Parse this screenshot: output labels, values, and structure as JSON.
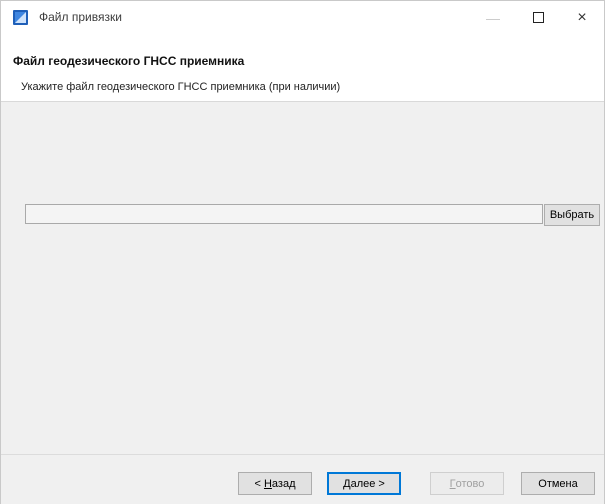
{
  "window": {
    "title": "Файл привязки",
    "controls": {
      "minimize": "—",
      "maximize": "",
      "close": "×"
    }
  },
  "header": {
    "title": "Файл геодезического ГНСС приемника",
    "subtitle": "Укажите файл геодезического ГНСС приемника (при наличии)"
  },
  "content": {
    "file_path_value": "",
    "choose_label": "Выбрать"
  },
  "footer": {
    "back_mnemonic": "Н",
    "back_rest": "азад",
    "back_prefix": "< ",
    "next_mnemonic": "Д",
    "next_rest": "алее >",
    "done_mnemonic": "Г",
    "done_rest": "отово",
    "cancel_label": "Отмена",
    "done_enabled": false
  },
  "colors": {
    "accent": "#0078d7",
    "panel": "#f0f0f0"
  }
}
